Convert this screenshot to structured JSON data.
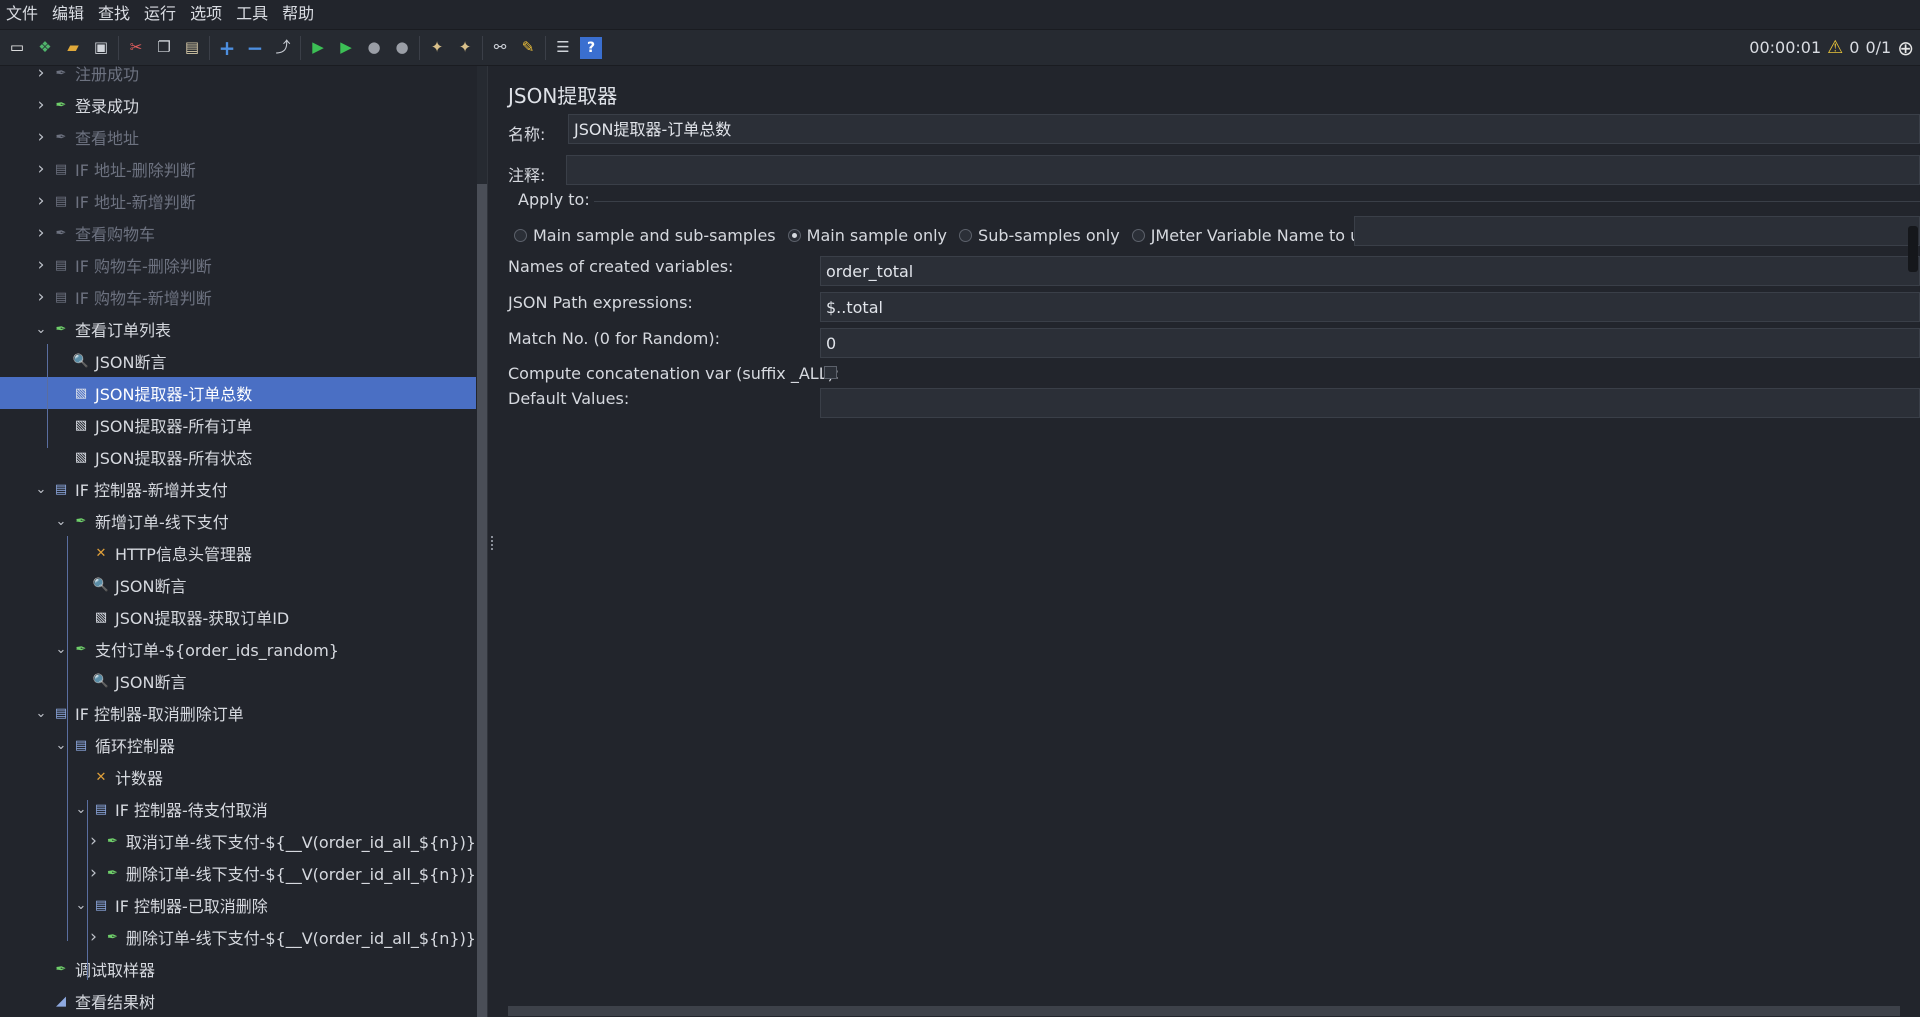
{
  "menu": [
    "文件",
    "编辑",
    "查找",
    "运行",
    "选项",
    "工具",
    "帮助"
  ],
  "toolbar": {
    "icons": [
      "new-icon",
      "templates-icon",
      "open-icon",
      "save-icon",
      "cut-icon",
      "copy-icon",
      "paste-icon",
      "expand-icon",
      "collapse-icon",
      "toggle-icon",
      "start-icon",
      "start-no-pause-icon",
      "stop-icon",
      "shutdown-icon",
      "clear-icon",
      "clear-all-icon",
      "search-icon",
      "reset-search-icon",
      "function-helper-icon",
      "help-icon"
    ],
    "timer": "00:00:01",
    "warning_count": "0",
    "threads": "0/1"
  },
  "tree": {
    "items": [
      {
        "label": "注册成功",
        "icon": "sampler",
        "level": 0,
        "chevron": "right",
        "disabled": true
      },
      {
        "label": "登录成功",
        "icon": "sampler",
        "level": 0,
        "chevron": "right",
        "disabled": false
      },
      {
        "label": "查看地址",
        "icon": "sampler",
        "level": 0,
        "chevron": "right",
        "disabled": true
      },
      {
        "label": "IF 地址-删除判断",
        "icon": "controller",
        "level": 0,
        "chevron": "right",
        "disabled": true
      },
      {
        "label": "IF 地址-新增判断",
        "icon": "controller",
        "level": 0,
        "chevron": "right",
        "disabled": true
      },
      {
        "label": "查看购物车",
        "icon": "sampler",
        "level": 0,
        "chevron": "right",
        "disabled": true
      },
      {
        "label": "IF 购物车-删除判断",
        "icon": "controller",
        "level": 0,
        "chevron": "right",
        "disabled": true
      },
      {
        "label": "IF 购物车-新增判断",
        "icon": "controller",
        "level": 0,
        "chevron": "right",
        "disabled": true
      },
      {
        "label": "查看订单列表",
        "icon": "sampler",
        "level": 0,
        "chevron": "down",
        "disabled": false
      },
      {
        "label": "JSON断言",
        "icon": "assertion",
        "level": 1,
        "chevron": "",
        "disabled": false
      },
      {
        "label": "JSON提取器-订单总数",
        "icon": "extractor",
        "level": 1,
        "chevron": "",
        "disabled": false,
        "selected": true
      },
      {
        "label": "JSON提取器-所有订单",
        "icon": "extractor",
        "level": 1,
        "chevron": "",
        "disabled": false
      },
      {
        "label": "JSON提取器-所有状态",
        "icon": "extractor",
        "level": 1,
        "chevron": "",
        "disabled": false
      },
      {
        "label": "IF 控制器-新增并支付",
        "icon": "controller",
        "level": 0,
        "chevron": "down",
        "disabled": false
      },
      {
        "label": "新增订单-线下支付",
        "icon": "sampler",
        "level": 1,
        "chevron": "down",
        "disabled": false
      },
      {
        "label": "HTTP信息头管理器",
        "icon": "config",
        "level": 2,
        "chevron": "",
        "disabled": false
      },
      {
        "label": "JSON断言",
        "icon": "assertion",
        "level": 2,
        "chevron": "",
        "disabled": false
      },
      {
        "label": "JSON提取器-获取订单ID",
        "icon": "extractor",
        "level": 2,
        "chevron": "",
        "disabled": false
      },
      {
        "label": "支付订单-${order_ids_random}",
        "icon": "sampler",
        "level": 1,
        "chevron": "down",
        "disabled": false
      },
      {
        "label": "JSON断言",
        "icon": "assertion",
        "level": 2,
        "chevron": "",
        "disabled": false
      },
      {
        "label": "IF 控制器-取消删除订单",
        "icon": "controller",
        "level": 0,
        "chevron": "down",
        "disabled": false
      },
      {
        "label": "循环控制器",
        "icon": "controller",
        "level": 1,
        "chevron": "down",
        "disabled": false
      },
      {
        "label": "计数器",
        "icon": "config",
        "level": 2,
        "chevron": "",
        "disabled": false
      },
      {
        "label": "IF 控制器-待支付取消",
        "icon": "controller",
        "level": 2,
        "chevron": "down",
        "disabled": false
      },
      {
        "label": "取消订单-线下支付-${__V(order_id_all_${n})}",
        "icon": "sampler",
        "level": 3,
        "chevron": "right",
        "disabled": false
      },
      {
        "label": "删除订单-线下支付-${__V(order_id_all_${n})}",
        "icon": "sampler",
        "level": 3,
        "chevron": "right",
        "disabled": false
      },
      {
        "label": "IF 控制器-已取消删除",
        "icon": "controller",
        "level": 2,
        "chevron": "down",
        "disabled": false
      },
      {
        "label": "删除订单-线下支付-${__V(order_id_all_${n})}",
        "icon": "sampler",
        "level": 3,
        "chevron": "right",
        "disabled": false
      },
      {
        "label": "调试取样器",
        "icon": "sampler",
        "level": 0,
        "chevron": "",
        "disabled": false
      },
      {
        "label": "查看结果树",
        "icon": "listener",
        "level": 0,
        "chevron": "",
        "disabled": false
      }
    ]
  },
  "panel": {
    "title": "JSON提取器",
    "name_label": "名称:",
    "name_value": "JSON提取器-订单总数",
    "comment_label": "注释:",
    "comment_value": "",
    "apply_to": {
      "legend": "Apply to:",
      "options": [
        {
          "label": "Main sample and sub-samples",
          "selected": false
        },
        {
          "label": "Main sample only",
          "selected": true
        },
        {
          "label": "Sub-samples only",
          "selected": false
        },
        {
          "label": "JMeter Variable Name to use",
          "selected": false
        }
      ],
      "variable_value": ""
    },
    "fields": [
      {
        "label": "Names of created variables:",
        "value": "order_total"
      },
      {
        "label": "JSON Path expressions:",
        "value": "$..total"
      },
      {
        "label": "Match No. (0 for Random):",
        "value": "0"
      }
    ],
    "concat_label": "Compute concatenation var (suffix _ALL):",
    "concat_checked": false,
    "default_label": "Default Values:",
    "default_value": ""
  },
  "colors": {
    "background": "#22252c",
    "selection": "#4a6fc4",
    "field": "#2b2f37"
  }
}
